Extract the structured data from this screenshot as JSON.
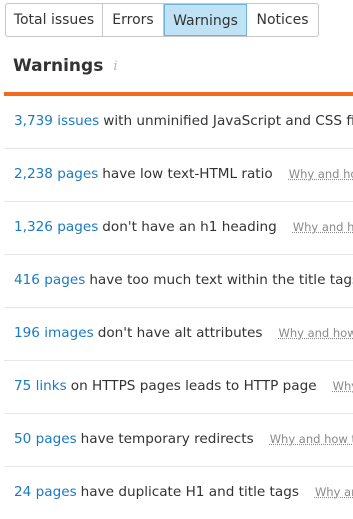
{
  "tabs": [
    {
      "label": "Total issues"
    },
    {
      "label": "Errors"
    },
    {
      "label": "Warnings"
    },
    {
      "label": "Notices"
    }
  ],
  "active_tab": "Warnings",
  "section": {
    "title": "Warnings",
    "info_icon": "i"
  },
  "accent_color": "#f26a1b",
  "link_color": "#1a7ac1",
  "issues": [
    {
      "count": "3,739 issues",
      "description": "with unminified JavaScript and CSS files",
      "why": ""
    },
    {
      "count": "2,238 pages",
      "description": "have low text-HTML ratio",
      "why": "Why and how to"
    },
    {
      "count": "1,326 pages",
      "description": "don't have an h1 heading",
      "why": "Why and how to"
    },
    {
      "count": "416 pages",
      "description": "have too much text within the title tags",
      "why": "W"
    },
    {
      "count": "196 images",
      "description": "don't have alt attributes",
      "why": "Why and how to fix"
    },
    {
      "count": "75 links",
      "description": "on HTTPS pages leads to HTTP page",
      "why": "Why and"
    },
    {
      "count": "50 pages",
      "description": "have temporary redirects",
      "why": "Why and how to fix it"
    },
    {
      "count": "24 pages",
      "description": "have duplicate H1 and title tags",
      "why": "Why and ho"
    }
  ]
}
